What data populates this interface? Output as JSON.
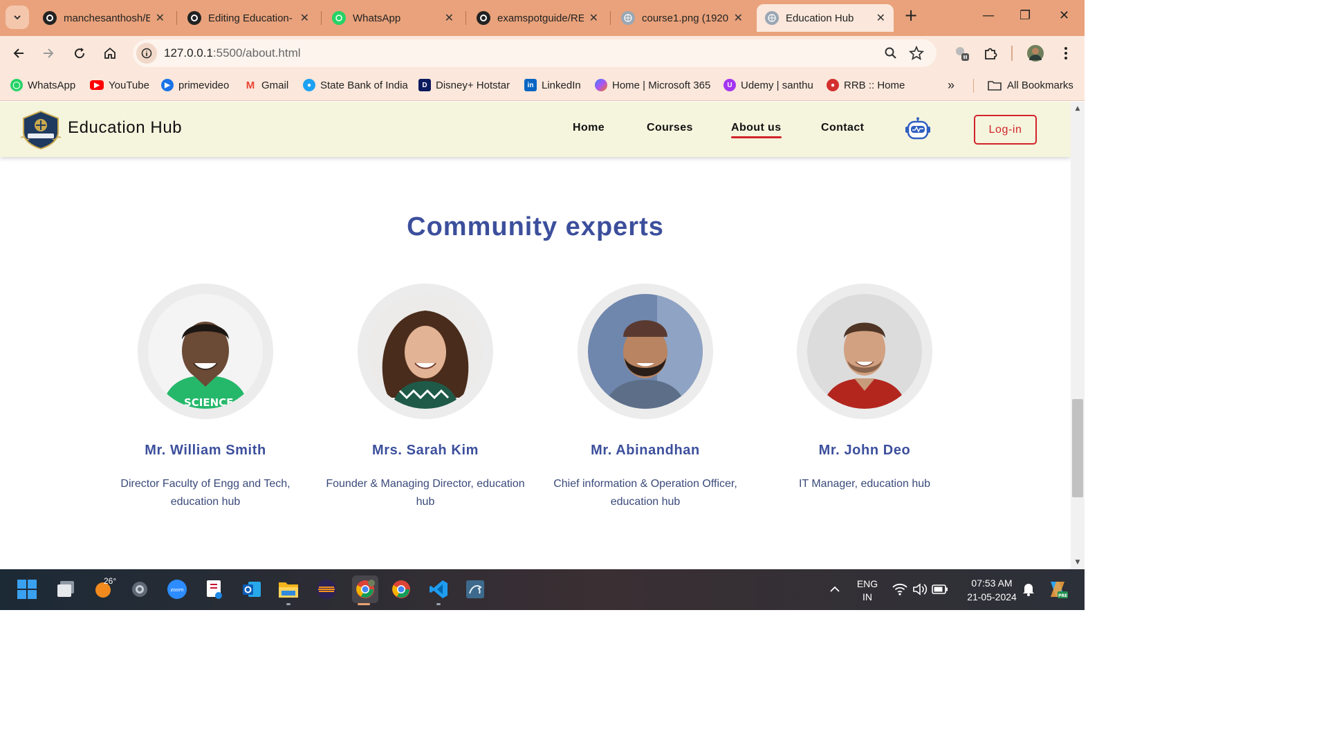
{
  "browser": {
    "tabs": [
      {
        "title": "manchesanthosh/E",
        "favicon": "github-icon",
        "active": false
      },
      {
        "title": "Editing Education-",
        "favicon": "github-icon",
        "active": false
      },
      {
        "title": "WhatsApp",
        "favicon": "whatsapp-icon",
        "active": false
      },
      {
        "title": "examspotguide/RE",
        "favicon": "github-icon",
        "active": false
      },
      {
        "title": "course1.png (1920",
        "favicon": "globe-icon",
        "active": false
      },
      {
        "title": "Education Hub",
        "favicon": "globe-icon",
        "active": true
      }
    ],
    "new_tab_symbol": "+",
    "address": {
      "host": "127.0.0.1",
      "rest": ":5500/about.html"
    },
    "bookmarks": [
      {
        "label": "WhatsApp",
        "icon": "whatsapp-icon",
        "color": "#25d366"
      },
      {
        "label": "YouTube",
        "icon": "youtube-icon",
        "color": "#ff0000"
      },
      {
        "label": "primevideo",
        "icon": "primevideo-icon",
        "color": "#1a73e8"
      },
      {
        "label": "Gmail",
        "icon": "gmail-icon",
        "color": "#ea4335"
      },
      {
        "label": "State Bank of India",
        "icon": "sbi-icon",
        "color": "#1da1f2"
      },
      {
        "label": "Disney+ Hotstar",
        "icon": "hotstar-icon",
        "color": "#0c1a5e"
      },
      {
        "label": "LinkedIn",
        "icon": "linkedin-icon",
        "color": "#0a66c2"
      },
      {
        "label": "Home | Microsoft 365",
        "icon": "microsoft365-icon",
        "color": "#7b61ff"
      },
      {
        "label": "Udemy | santhu",
        "icon": "udemy-icon",
        "color": "#a435f0"
      },
      {
        "label": "RRB :: Home",
        "icon": "rrb-icon",
        "color": "#d32f2f"
      }
    ],
    "overflow_symbol": "»",
    "all_bookmarks_label": "All Bookmarks"
  },
  "site": {
    "brand": "Education Hub",
    "nav": [
      {
        "label": "Home",
        "active": false
      },
      {
        "label": "Courses",
        "active": false
      },
      {
        "label": "About us",
        "active": true
      },
      {
        "label": "Contact",
        "active": false
      }
    ],
    "login_label": "Log-in",
    "section_title": "Community experts",
    "experts": [
      {
        "name": "Mr. William Smith",
        "role": "Director Faculty of Engg and Tech, education hub"
      },
      {
        "name": "Mrs. Sarah Kim",
        "role": "Founder & Managing Director, education hub"
      },
      {
        "name": "Mr. Abinandhan",
        "role": "Chief information & Operation Officer, education hub"
      },
      {
        "name": "Mr. John Deo",
        "role": "IT Manager, education hub"
      }
    ],
    "colors": {
      "accent": "#3c4f9c",
      "login_red": "#d2232a",
      "header_bg": "#f5f4dd"
    }
  },
  "taskbar": {
    "weather": "26°",
    "lang_primary": "ENG",
    "lang_secondary": "IN",
    "time": "07:53 AM",
    "date": "21-05-2024"
  }
}
